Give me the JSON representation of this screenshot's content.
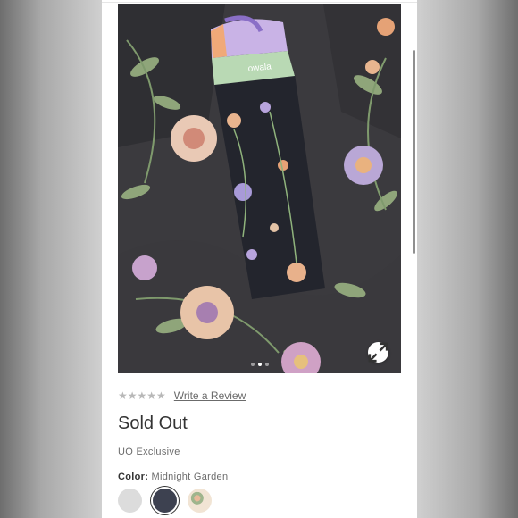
{
  "product": {
    "rating_stars": "★★★★★",
    "review_link": "Write a Review",
    "status": "Sold Out",
    "exclusive_tag": "UO Exclusive",
    "color_label": "Color:",
    "color_value": "Midnight Garden",
    "brand_on_bottle": "owala"
  },
  "gallery": {
    "current_index": 1,
    "total": 3
  },
  "swatches": [
    {
      "name": "light-gray",
      "color": "#dcdcdc"
    },
    {
      "name": "midnight-garden",
      "color": "#3d4150",
      "selected": true
    },
    {
      "name": "floral-cream",
      "color": "#f1e4d4"
    }
  ],
  "colors": {
    "scrollbar": "#8f8f8f",
    "text_primary": "#333333",
    "text_secondary": "#6b6b6b",
    "stars": "#b8b8b8"
  },
  "icons": {
    "expand": "expand-icon"
  }
}
